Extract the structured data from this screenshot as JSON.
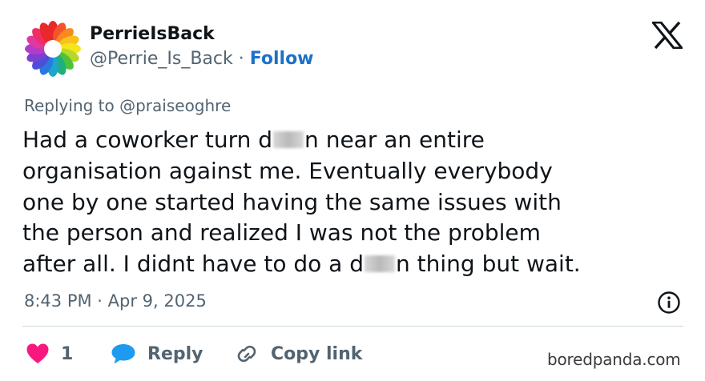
{
  "author": {
    "display_name": "PerrieIsBack",
    "handle": "@Perrie_Is_Back",
    "separator": "·",
    "follow_label": "Follow"
  },
  "tweet": {
    "replying_to": "Replying to @praiseoghre",
    "lines": [
      {
        "before": "Had a coworker turn d",
        "after": "n near an entire"
      },
      {
        "text": "organisation against me. Eventually everybody"
      },
      {
        "text": "one by one started having the same issues with"
      },
      {
        "text": "the person and realized I was not the problem"
      },
      {
        "before": "after all. I didnt have to do a d",
        "after": "n thing but wait."
      }
    ],
    "timestamp": "8:43 PM · Apr 9, 2025"
  },
  "actions": {
    "like_count": "1",
    "reply_label": "Reply",
    "copy_link_label": "Copy link"
  },
  "icons": {
    "platform": "x-logo-icon",
    "info": "info-icon",
    "like": "heart-icon",
    "reply": "speech-bubble-icon",
    "copy": "link-icon"
  },
  "colors": {
    "link_blue": "#1d71c4",
    "heart_pink": "#f91880",
    "reply_blue": "#1d9bf0",
    "secondary_text": "#536471"
  },
  "watermark": "boredpanda.com"
}
